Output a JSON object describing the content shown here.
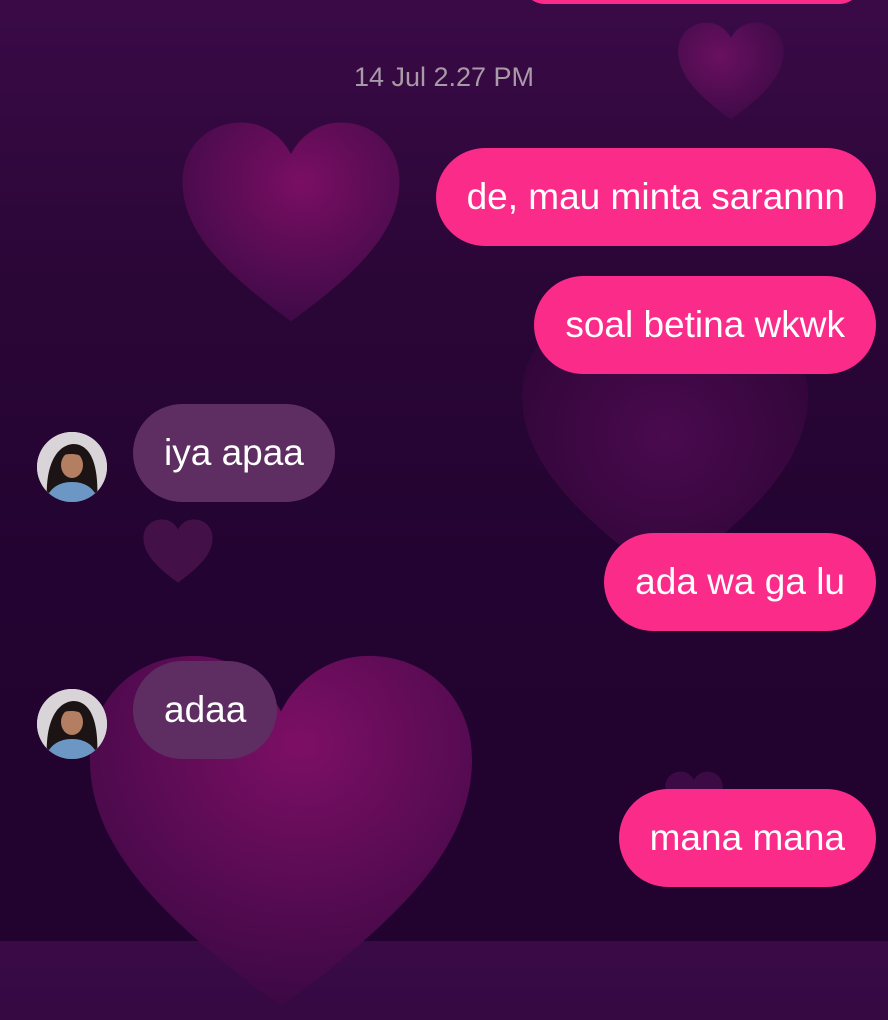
{
  "thread": {
    "timestamp": "14 Jul 2.27 PM",
    "messages": [
      {
        "direction": "outgoing",
        "text": "de, mau minta sarannn"
      },
      {
        "direction": "outgoing",
        "text": "soal betina wkwk"
      },
      {
        "direction": "incoming",
        "text": "iya apaa"
      },
      {
        "direction": "outgoing",
        "text": "ada wa ga lu"
      },
      {
        "direction": "incoming",
        "text": "adaa"
      },
      {
        "direction": "outgoing",
        "text": "mana mana"
      }
    ]
  },
  "colors": {
    "outgoing_bubble": "#fb2b8a",
    "incoming_bubble": "#5e2e63",
    "background_top": "#3a0a47",
    "background_bottom": "#22032f",
    "timestamp_text": "#a89aa6",
    "heart": "#7a0e63"
  },
  "icons": {
    "background": "heart-icon",
    "avatar": "user-avatar"
  }
}
